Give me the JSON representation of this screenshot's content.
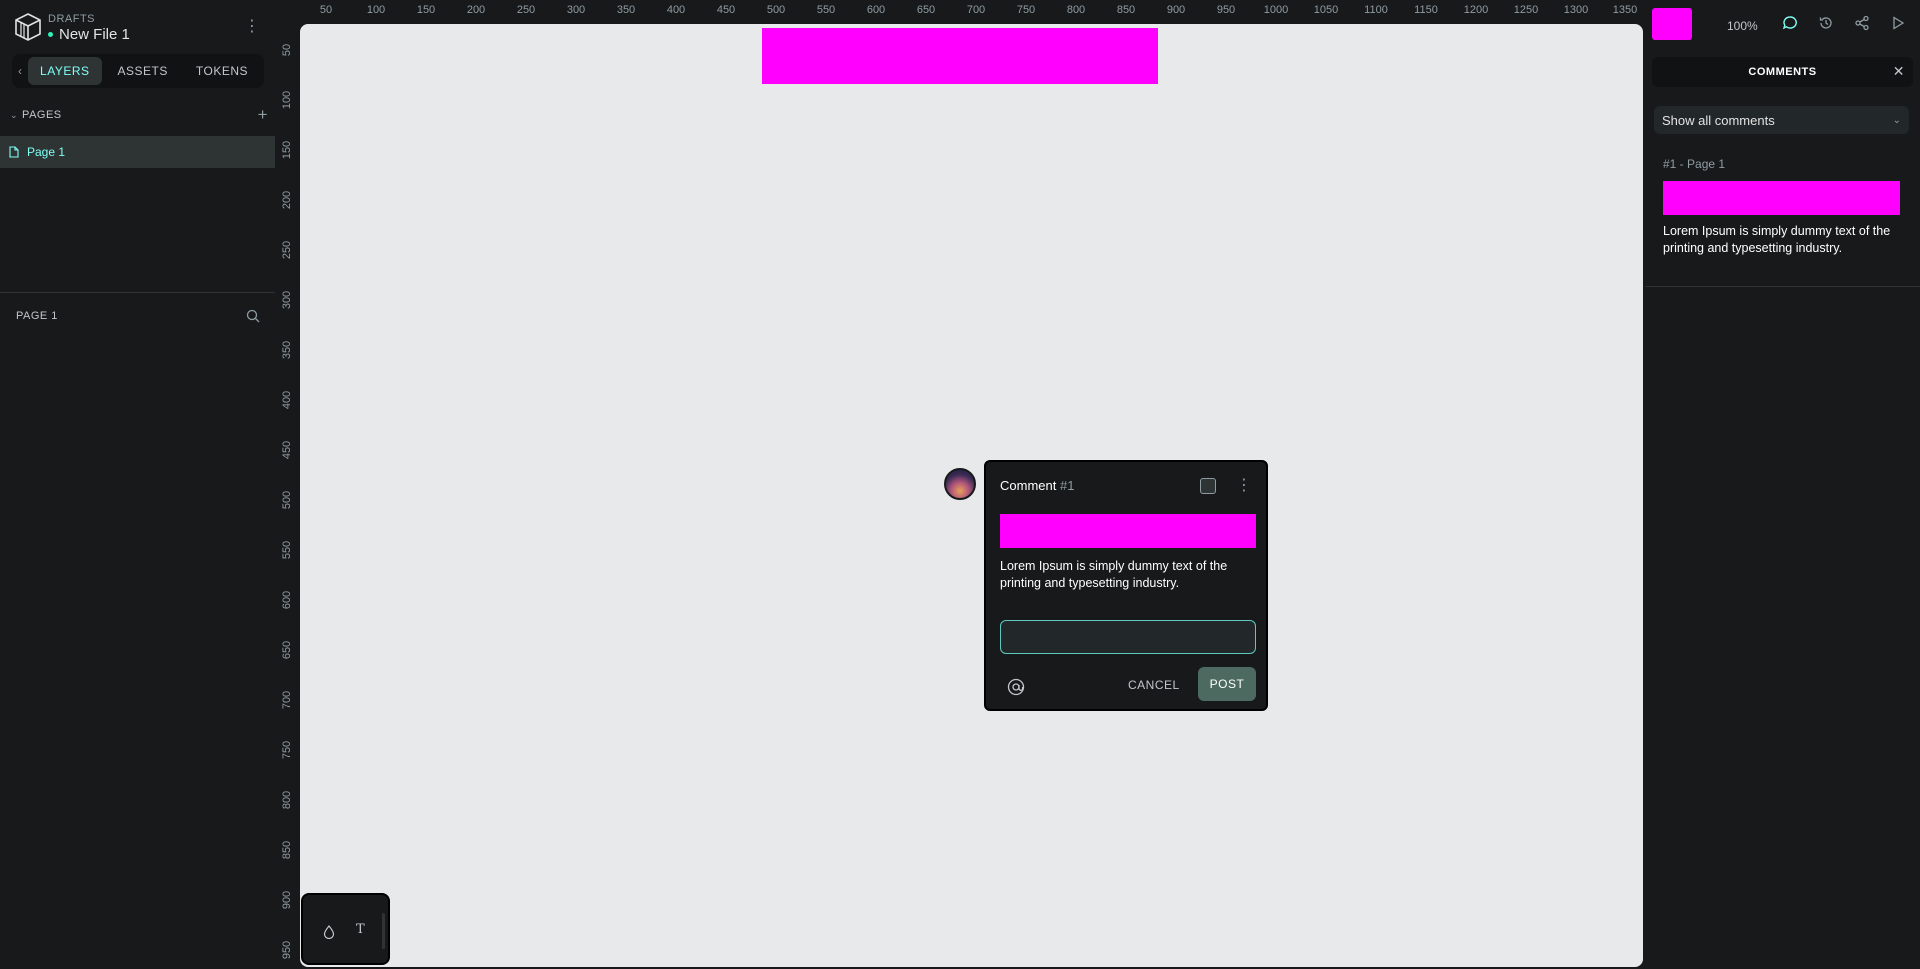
{
  "header": {
    "project": "DRAFTS",
    "file_name": "New File 1"
  },
  "sidebar": {
    "tabs": [
      {
        "label": "LAYERS",
        "active": true
      },
      {
        "label": "ASSETS",
        "active": false
      },
      {
        "label": "TOKENS",
        "active": false
      }
    ],
    "pages_title": "PAGES",
    "pages": [
      {
        "label": "Page 1",
        "active": true
      }
    ],
    "layers_title": "PAGE 1"
  },
  "rulers": {
    "top": [
      "50",
      "100",
      "150",
      "200",
      "250",
      "300",
      "350",
      "400",
      "450",
      "500",
      "550",
      "600",
      "650",
      "700",
      "750",
      "800",
      "850",
      "900",
      "950",
      "1000",
      "1050",
      "1100",
      "1150",
      "1200",
      "1250",
      "1300",
      "1350"
    ],
    "left": [
      "50",
      "100",
      "150",
      "200",
      "250",
      "300",
      "350",
      "400",
      "450",
      "500",
      "550",
      "600",
      "650",
      "700",
      "750",
      "800",
      "850",
      "900",
      "950"
    ]
  },
  "comment_popup": {
    "title": "Comment",
    "number": "#1",
    "text": "Lorem Ipsum is simply dummy text of the printing and typesetting industry.",
    "reply_value": "",
    "cancel_label": "CANCEL",
    "post_label": "POST"
  },
  "right_panel": {
    "zoom": "100%",
    "comments_title": "COMMENTS",
    "filter_value": "Show all comments",
    "thread": {
      "meta": "#1 - Page 1",
      "text": "Lorem Ipsum is simply dummy text of the printing and typesetting industry."
    }
  },
  "colors": {
    "accent": "#7efff5",
    "highlight": "#ff00ff",
    "panel": "#18191b",
    "canvas": "#e8e9ea"
  },
  "icons": [
    "app-logo-icon",
    "kebab-icon",
    "chevron-left-icon",
    "chevron-down-icon",
    "plus-icon",
    "page-icon",
    "search-icon",
    "more-icon",
    "at-mention-icon",
    "drop-icon",
    "text-tool-icon",
    "comments-icon",
    "history-icon",
    "share-icon",
    "play-icon",
    "close-icon"
  ]
}
